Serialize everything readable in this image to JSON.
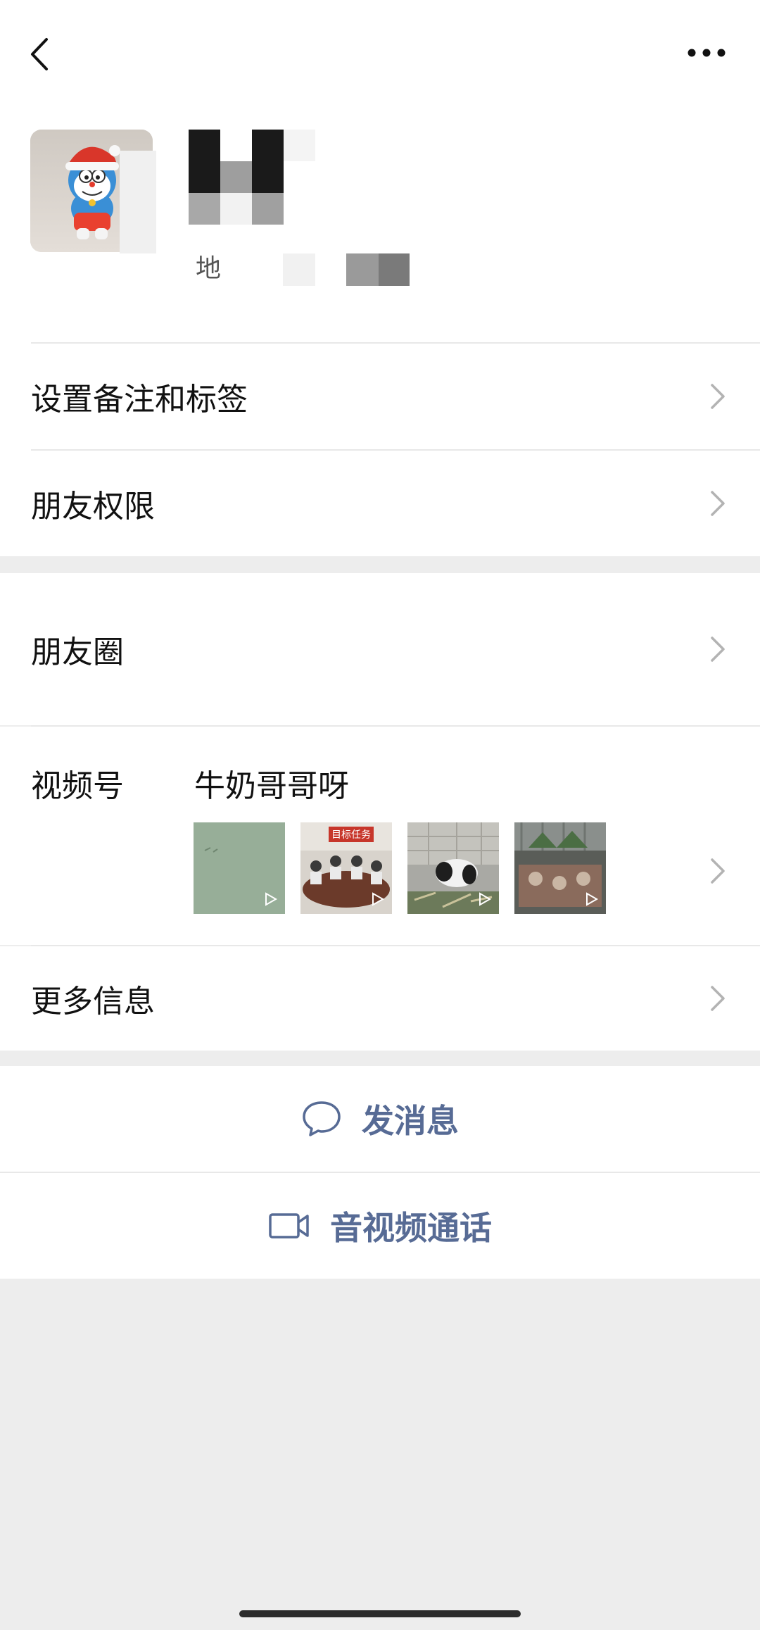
{
  "header": {
    "back_icon": "chevron-left-icon",
    "more_icon": "ellipsis-icon"
  },
  "profile": {
    "avatar_desc": "doraemon-santa-hat-avatar",
    "region_label": "地"
  },
  "rows": {
    "remark_tags": "设置备注和标签",
    "friend_permissions": "朋友权限",
    "moments": "朋友圈",
    "channels_label": "视频号",
    "channels_name": "牛奶哥哥呀",
    "channels_thumb_tag": "目标任务",
    "more_info": "更多信息"
  },
  "actions": {
    "send_message": "发消息",
    "send_message_icon": "chat-bubble-icon",
    "av_call": "音视频通话",
    "av_call_icon": "video-camera-icon"
  },
  "colors": {
    "accent": "#576b95",
    "background": "#ededed",
    "surface": "#ffffff",
    "divider": "#e8e8e8"
  }
}
